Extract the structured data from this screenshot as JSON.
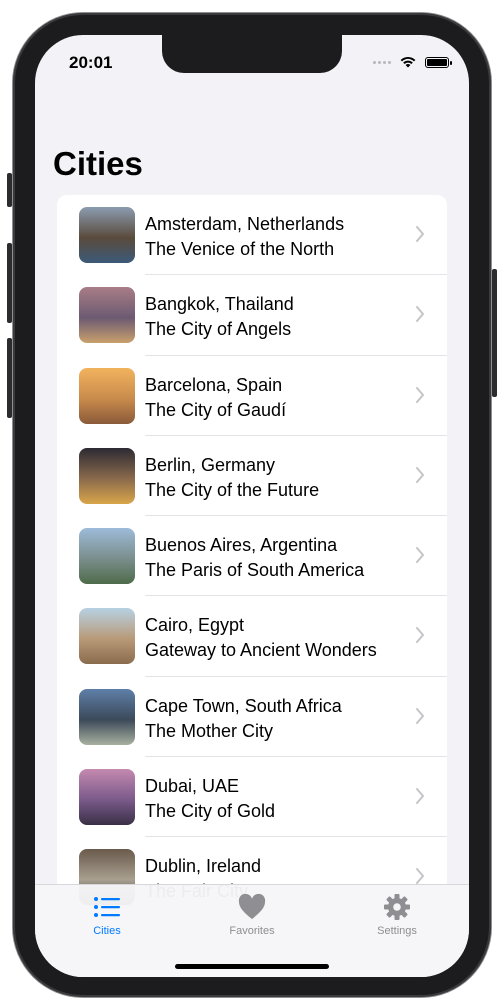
{
  "status_bar": {
    "time": "20:01"
  },
  "nav": {
    "title": "Cities"
  },
  "cities": [
    {
      "name": "Amsterdam, Netherlands",
      "tagline": "The Venice of the North",
      "thumb_colors": [
        "#8b9cb0",
        "#5a4a3c",
        "#3c5a7a"
      ]
    },
    {
      "name": "Bangkok, Thailand",
      "tagline": "The City of Angels",
      "thumb_colors": [
        "#a87d86",
        "#6c5a72",
        "#c9a06c"
      ]
    },
    {
      "name": "Barcelona, Spain",
      "tagline": "The City of Gaudí",
      "thumb_colors": [
        "#f2b35e",
        "#c98b4c",
        "#8a5a3a"
      ]
    },
    {
      "name": "Berlin, Germany",
      "tagline": "The City of the Future",
      "thumb_colors": [
        "#2c2a33",
        "#8a6a4c",
        "#d9a64a"
      ]
    },
    {
      "name": "Buenos Aires, Argentina",
      "tagline": "The Paris of South America",
      "thumb_colors": [
        "#9dbbd9",
        "#7a8e8c",
        "#4e6b4a"
      ]
    },
    {
      "name": "Cairo, Egypt",
      "tagline": "Gateway to Ancient Wonders",
      "thumb_colors": [
        "#b7d1e3",
        "#b89a78",
        "#8a6c4e"
      ]
    },
    {
      "name": "Cape Town, South Africa",
      "tagline": "The Mother City",
      "thumb_colors": [
        "#5e7fa8",
        "#3c4a5a",
        "#a8b0a0"
      ]
    },
    {
      "name": "Dubai, UAE",
      "tagline": "The City of Gold",
      "thumb_colors": [
        "#c48ab0",
        "#7a5a8a",
        "#3a3046"
      ]
    },
    {
      "name": "Dublin, Ireland",
      "tagline": "The Fair City",
      "thumb_colors": [
        "#6a5a4c",
        "#a8a090",
        "#3c3a34"
      ]
    }
  ],
  "tabs": [
    {
      "label": "Cities",
      "icon": "list-icon",
      "active": true
    },
    {
      "label": "Favorites",
      "icon": "heart-icon",
      "active": false
    },
    {
      "label": "Settings",
      "icon": "gear-icon",
      "active": false
    }
  ],
  "colors": {
    "accent": "#007aff",
    "inactive": "#8e8e93"
  }
}
